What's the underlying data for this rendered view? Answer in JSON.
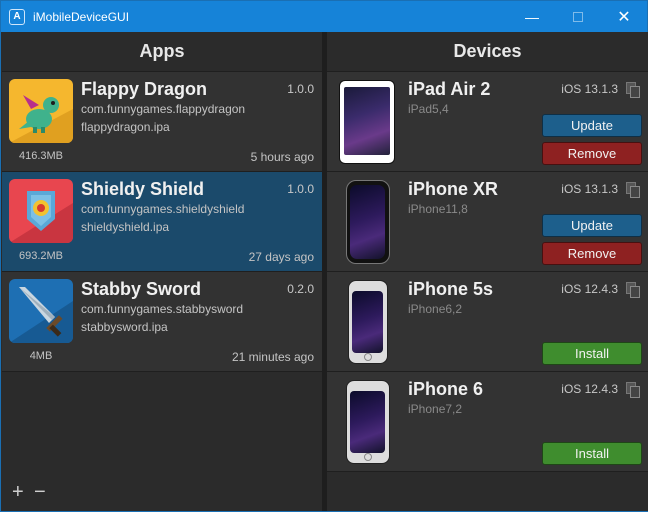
{
  "window": {
    "title": "iMobileDeviceGUI"
  },
  "apps_panel": {
    "header": "Apps",
    "apps": [
      {
        "name": "Flappy Dragon",
        "bundle_id": "com.funnygames.flappydragon",
        "file": "flappydragon.ipa",
        "version": "1.0.0",
        "size": "416.3MB",
        "time": "5 hours ago",
        "icon": "dragon-app-icon"
      },
      {
        "name": "Shieldy Shield",
        "bundle_id": "com.funnygames.shieldyshield",
        "file": "shieldyshield.ipa",
        "version": "1.0.0",
        "size": "693.2MB",
        "time": "27 days ago",
        "icon": "shield-app-icon"
      },
      {
        "name": "Stabby Sword",
        "bundle_id": "com.funnygames.stabbysword",
        "file": "stabbysword.ipa",
        "version": "0.2.0",
        "size": "4MB",
        "time": "21 minutes ago",
        "icon": "sword-app-icon"
      }
    ],
    "footer": {
      "add": "+",
      "remove": "−"
    }
  },
  "devices_panel": {
    "header": "Devices",
    "devices": [
      {
        "name": "iPad Air 2",
        "model": "iPad5,4",
        "ios": "iOS 13.1.3",
        "buttons": [
          "Update",
          "Remove"
        ],
        "image": "ipad-image"
      },
      {
        "name": "iPhone XR",
        "model": "iPhone11,8",
        "ios": "iOS 13.1.3",
        "buttons": [
          "Update",
          "Remove"
        ],
        "image": "iphone-xr-image"
      },
      {
        "name": "iPhone 5s",
        "model": "iPhone6,2",
        "ios": "iOS 12.4.3",
        "buttons": [
          "Install"
        ],
        "image": "iphone-5s-image"
      },
      {
        "name": "iPhone 6",
        "model": "iPhone7,2",
        "ios": "iOS 12.4.3",
        "buttons": [
          "Install"
        ],
        "image": "iphone-6-image"
      }
    ]
  },
  "colors": {
    "titlebar": "#1683d8",
    "selected_row": "#1b4a6b",
    "update": "#1d5f8c",
    "remove": "#8e2121",
    "install": "#3f8d2e"
  }
}
